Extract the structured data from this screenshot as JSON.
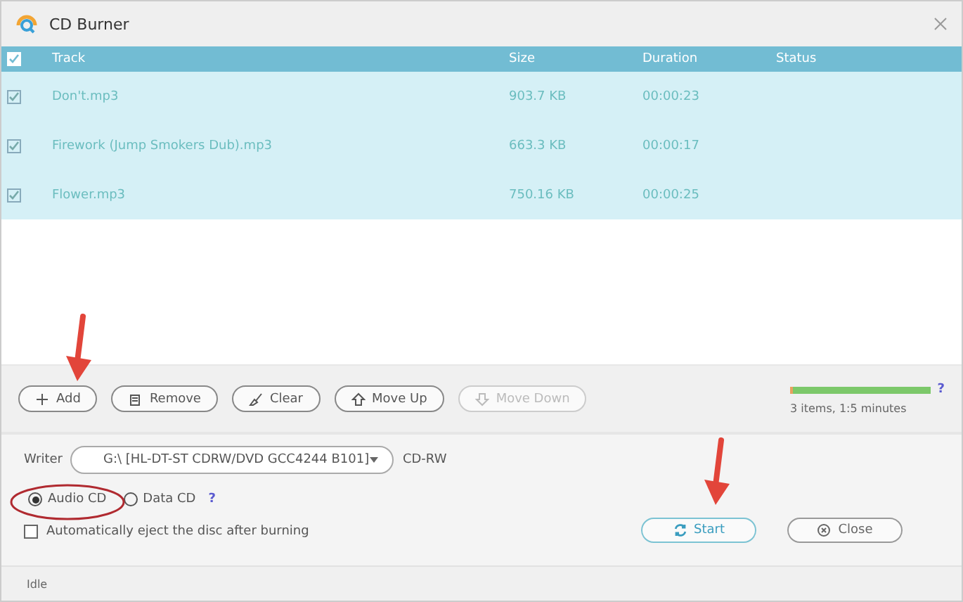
{
  "window": {
    "title": "CD Burner"
  },
  "table": {
    "select_all": {
      "checked": true
    },
    "columns": [
      "Track",
      "Size",
      "Duration",
      "Status"
    ],
    "rows": [
      {
        "checked": true,
        "track": "Don't.mp3",
        "size": "903.7 KB",
        "duration": "00:00:23"
      },
      {
        "checked": true,
        "track": "Firework (Jump Smokers Dub).mp3",
        "size": "663.3 KB",
        "duration": "00:00:17"
      },
      {
        "checked": true,
        "track": "Flower.mp3",
        "size": "750.16 KB",
        "duration": "00:00:25"
      }
    ]
  },
  "toolbar": [
    {
      "kind": "add",
      "label": "Add",
      "disabled": false
    },
    {
      "kind": "remove",
      "label": "Remove",
      "disabled": false
    },
    {
      "kind": "clear",
      "label": "Clear",
      "disabled": false
    },
    {
      "kind": "up",
      "label": "Move Up",
      "disabled": false
    },
    {
      "kind": "down",
      "label": "Move Down",
      "disabled": true
    }
  ],
  "capacity": {
    "level": 1,
    "help": "?",
    "summary": "3 items, 1:5 minutes"
  },
  "writer": {
    "label": "Writer",
    "value": "G:\\ [HL-DT-ST CDRW/DVD GCC4244 B101]",
    "disc_type": "CD-RW"
  },
  "modes": [
    {
      "label": "Audio CD",
      "selected": true
    },
    {
      "label": "Data CD",
      "selected": false
    }
  ],
  "modes_help": "?",
  "eject": {
    "label": "Automatically eject the disc after burning",
    "checked": false
  },
  "actions": [
    {
      "kind": "start",
      "label": "Start",
      "primary": true
    },
    {
      "kind": "close",
      "label": "Close",
      "primary": false
    }
  ],
  "status": "Idle"
}
